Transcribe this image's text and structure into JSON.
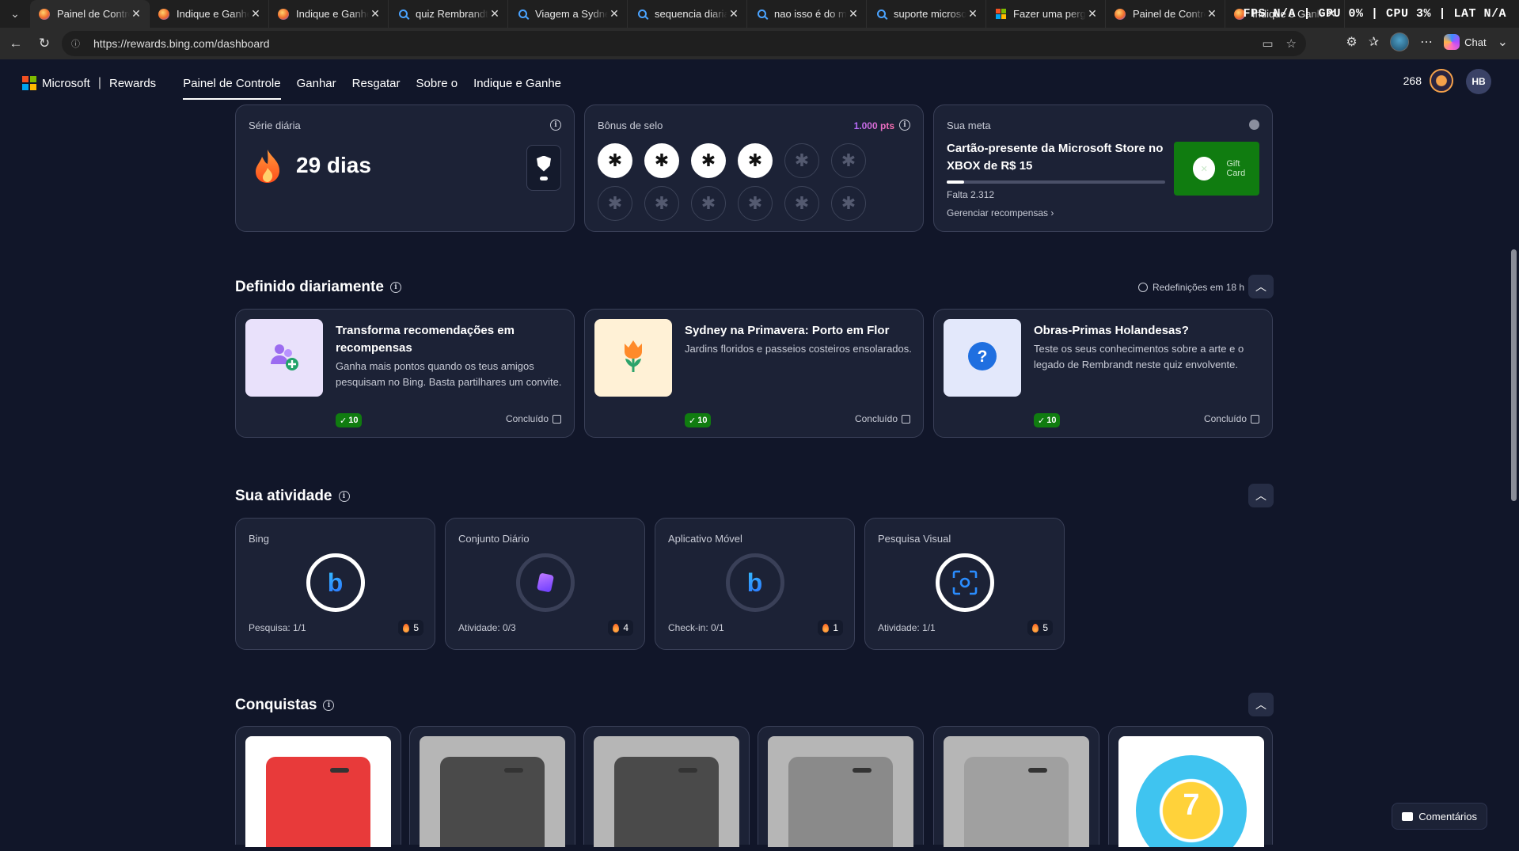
{
  "browser": {
    "tabs": [
      {
        "title": "Painel de Controle",
        "favicon": "rewards-icon",
        "active": true
      },
      {
        "title": "Indique e Ganhe - ",
        "favicon": "rewards-icon",
        "active": false
      },
      {
        "title": "Indique e Ganhe - ",
        "favicon": "rewards-icon",
        "active": false
      },
      {
        "title": "quiz Rembrandt - ",
        "favicon": "search-icon",
        "active": false
      },
      {
        "title": "Viagem a Sydney ",
        "favicon": "search-icon",
        "active": false
      },
      {
        "title": "sequencia diaria b",
        "favicon": "search-icon",
        "active": false
      },
      {
        "title": "nao isso é do mic",
        "favicon": "search-icon",
        "active": false
      },
      {
        "title": "suporte microsoft",
        "favicon": "search-icon",
        "active": false
      },
      {
        "title": "Fazer uma pergun",
        "favicon": "microsoft-icon",
        "active": false
      },
      {
        "title": "Painel de Control",
        "favicon": "rewards-icon",
        "active": false
      },
      {
        "title": "Indique e Ganhe",
        "favicon": "rewards-icon",
        "active": false
      }
    ],
    "overlay": "FPS N/A | GPU 0% | CPU 3% | LAT N/A",
    "url": "https://rewards.bing.com/dashboard",
    "chat_label": "Chat"
  },
  "header": {
    "brand": "Microsoft",
    "product": "Rewards",
    "nav": [
      "Painel de Controle",
      "Ganhar",
      "Resgatar",
      "Sobre o",
      "Indique e Ganhe"
    ],
    "points": "268",
    "avatar_initials": "HB"
  },
  "streak": {
    "label": "Série diária",
    "value": "29 dias"
  },
  "stamp_bonus": {
    "label": "Bônus de selo",
    "points": "1.000 pts",
    "stamps_total": 12,
    "stamps_earned": 4
  },
  "goal": {
    "label": "Sua meta",
    "title": "Cartão-presente da Microsoft Store no XBOX de R$ 15",
    "progress": 0.08,
    "remaining": "Falta 2.312",
    "manage_link": "Gerenciar recompensas",
    "giftcard_text": "Gift Card",
    "giftcard_color": "#107C10"
  },
  "daily_set": {
    "title": "Definido diariamente",
    "reset": "Redefinições em 18 h",
    "cards": [
      {
        "title": "Transforma recomendações em recompensas",
        "desc": "Ganha mais pontos quando os teus amigos pesquisam no Bing. Basta partilhares um convite.",
        "points": "10",
        "status": "Concluído",
        "icon": "referral-users-icon",
        "thumb_bg": "#E9E1FB"
      },
      {
        "title": "Sydney na Primavera: Porto em Flor",
        "desc": "Jardins floridos e passeios costeiros ensolarados.",
        "points": "10",
        "status": "Concluído",
        "icon": "tulip-icon",
        "thumb_bg": "#FFF1D6"
      },
      {
        "title": "Obras-Primas Holandesas?",
        "desc": "Teste os seus conhecimentos sobre a arte e o legado de Rembrandt neste quiz envolvente.",
        "points": "10",
        "status": "Concluído",
        "icon": "question-icon",
        "thumb_bg": "#E3E8FB"
      }
    ]
  },
  "activity": {
    "title": "Sua atividade",
    "cards": [
      {
        "label": "Bing",
        "footer": "Pesquisa: 1/1",
        "streak": "5",
        "complete": true,
        "icon": "bing-icon"
      },
      {
        "label": "Conjunto Diário",
        "footer": "Atividade: 0/3",
        "streak": "4",
        "complete": false,
        "icon": "daily-set-icon"
      },
      {
        "label": "Aplicativo Móvel",
        "footer": "Check-in: 0/1",
        "streak": "1",
        "complete": false,
        "icon": "bing-icon"
      },
      {
        "label": "Pesquisa Visual",
        "footer": "Atividade: 1/1",
        "streak": "5",
        "complete": true,
        "icon": "visual-search-icon"
      }
    ]
  },
  "achievements": {
    "title": "Conquistas",
    "badges": [
      {
        "name": "clippy-badge-icon",
        "color": "#E83A3A",
        "unlocked": true
      },
      {
        "name": "chip-8088-badge-icon",
        "color": "#4A4A4A",
        "unlocked": false
      },
      {
        "name": "pc-windows-badge-icon",
        "color": "#4A4A4A",
        "unlocked": false
      },
      {
        "name": "seattle-skyline-badge-icon",
        "color": "#8A8A8A",
        "unlocked": false
      },
      {
        "name": "microsoft-logo-badge-icon",
        "color": "#A0A0A0",
        "unlocked": false
      },
      {
        "name": "streak-7-badge-icon",
        "color": "#3FC4F0",
        "unlocked": true,
        "value": "7"
      }
    ]
  },
  "feedback": {
    "label": "Comentários"
  }
}
